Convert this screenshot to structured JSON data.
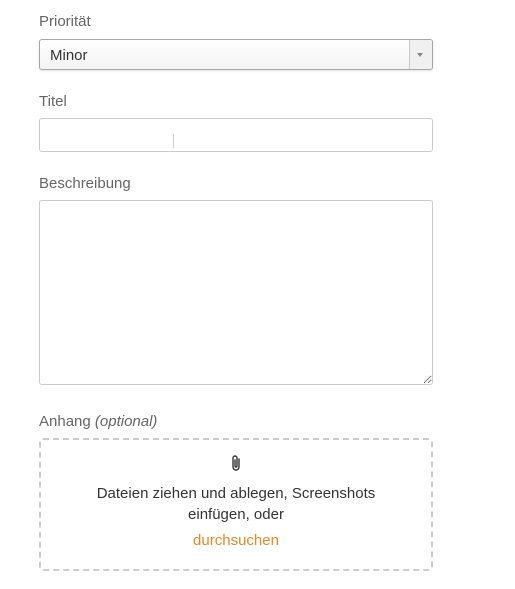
{
  "form": {
    "priority": {
      "label": "Priorität",
      "selected_value": "Minor",
      "arrow_icon": "chevron-down-icon"
    },
    "title": {
      "label": "Titel",
      "value": "",
      "placeholder": ""
    },
    "description": {
      "label": "Beschreibung",
      "value": ""
    },
    "attachment": {
      "label": "Anhang",
      "optional_label": "(optional)",
      "icon": "paperclip-icon",
      "instructions": "Dateien ziehen und ablegen, Screenshots einfügen, oder",
      "browse_link": "durchsuchen"
    }
  },
  "colors": {
    "label_text": "#666666",
    "border": "#cccccc",
    "link": "#e08a2b",
    "body_text": "#333333"
  }
}
